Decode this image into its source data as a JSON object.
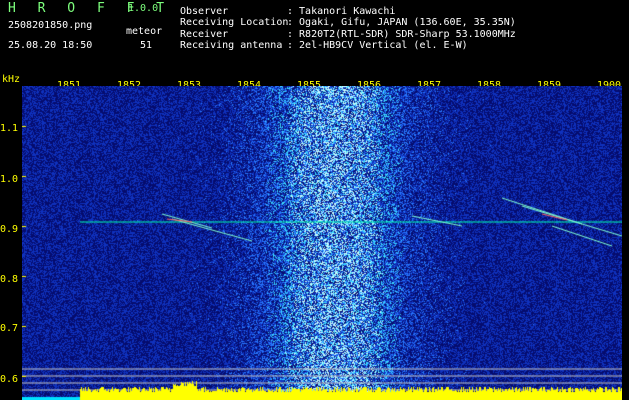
{
  "app": {
    "name": "H R O F F T",
    "version": "1.0.0",
    "filename": "2508201850.png",
    "datetime": "25.08.20 18:50",
    "detection_label": "meteor",
    "detection_count": "51"
  },
  "info": [
    {
      "key": "Observer",
      "value": ": Takanori Kawachi"
    },
    {
      "key": "Receiving Location",
      "value": ": Ogaki, Gifu, JAPAN (136.60E, 35.35N)"
    },
    {
      "key": "Receiver",
      "value": ": R820T2(RTL-SDR) SDR-Sharp 53.1000MHz"
    },
    {
      "key": "Receiving antenna",
      "value": ": 2el-HB9CV Vertical (el. E-W)"
    }
  ],
  "axis": {
    "unit": "kHz",
    "y_ticks": [
      "1.1",
      "1.0",
      "0.9",
      "0.8",
      "0.7",
      "0.6"
    ],
    "x_ticks": [
      "1851",
      "1852",
      "1853",
      "1854",
      "1855",
      "1856",
      "1857",
      "1858",
      "1859",
      "1900"
    ]
  },
  "colors": {
    "background": "#000000",
    "header_text": "#ffffff",
    "title_green": "#7dff7d",
    "axis_yellow": "#ffff00",
    "noise_dark": "#0a1a8c",
    "noise_bright": "#3a7dff",
    "trace_color": "#00ffb0",
    "amplitude_bar": "#ffff00",
    "amplitude_cyan": "#00e0ff"
  }
}
